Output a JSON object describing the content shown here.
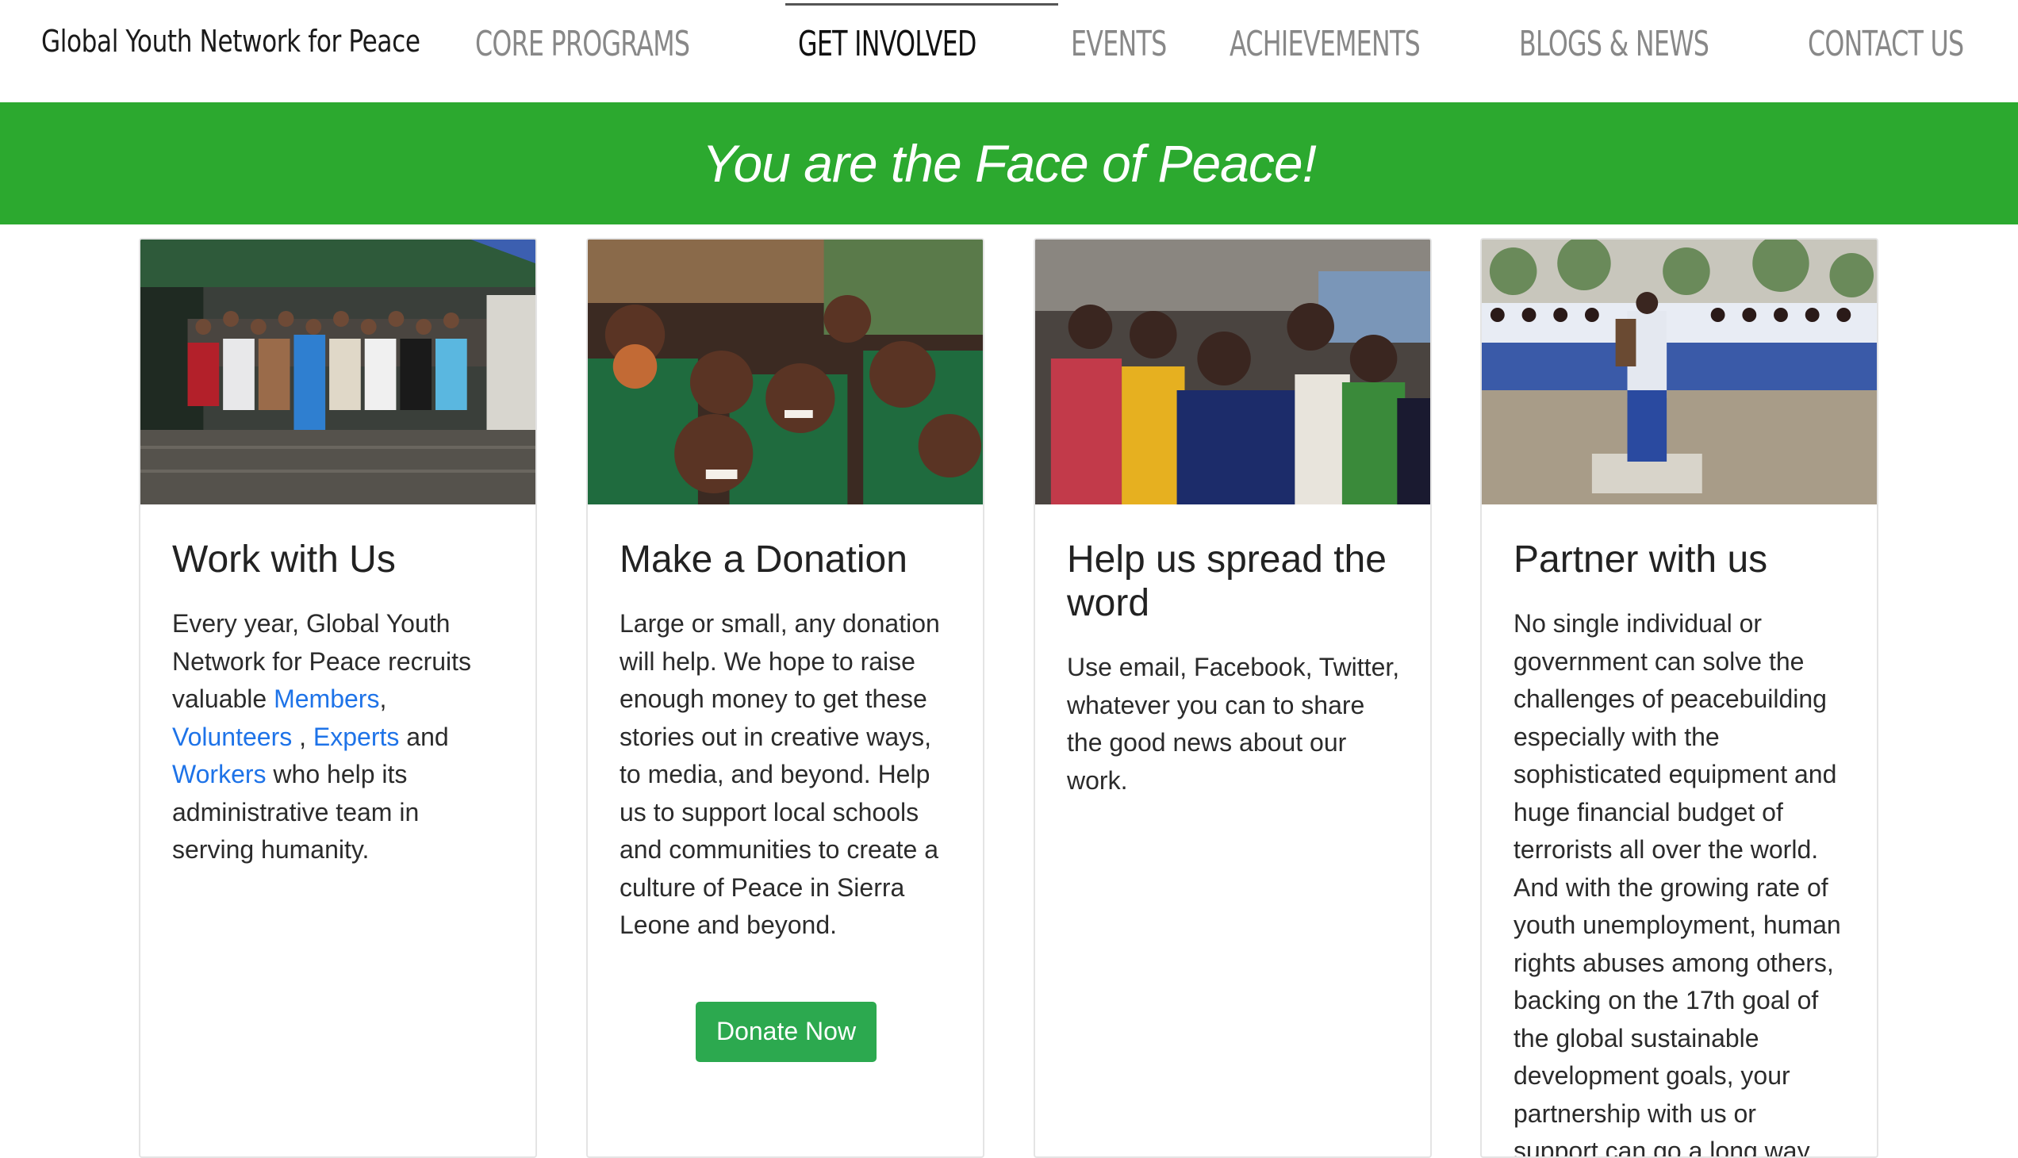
{
  "header": {
    "brand": "Global Youth Network for Peace",
    "nav": [
      {
        "label": "CORE PROGRAMS"
      },
      {
        "label": "GET INVOLVED"
      },
      {
        "label": "EVENTS"
      },
      {
        "label": "ACHIEVEMENTS"
      },
      {
        "label": "BLOGS & NEWS"
      },
      {
        "label": "CONTACT US"
      }
    ],
    "active_nav": "GET INVOLVED"
  },
  "banner": {
    "text": "You are the Face of Peace!",
    "color": "#2ca92f"
  },
  "cards": [
    {
      "title": "Work with Us",
      "text_before": "Every year, Global Youth Network for Peace recruits valuable ",
      "link_members": "Members",
      "sep1": ", ",
      "link_volunteers": "Volunteers",
      "sep2": " , ",
      "link_experts": "Experts",
      "sep3": " and ",
      "link_workers": "Workers",
      "text_after": " who help its administrative team in serving humanity."
    },
    {
      "title": "Make a Donation",
      "text": "Large or small, any donation will help. We hope to raise enough money to get these stories out in creative ways, to media, and beyond. Help us to support local schools and communities to create a culture of Peace in Sierra Leone and beyond.",
      "button": "Donate Now"
    },
    {
      "title": "Help us spread the word",
      "text": "Use email, Facebook, Twitter, whatever you can to share the good news about our work."
    },
    {
      "title": "Partner with us",
      "text": "No single individual or government can solve the challenges of peacebuilding especially with the sophisticated equipment and huge financial budget of terrorists all over the world. And with the growing rate of youth unemployment, human rights abuses among others, backing on the 17th goal of the global sustainable development goals, your partnership with us or support can go a long way"
    }
  ],
  "colors": {
    "accent_green": "#2ca92f",
    "button_green": "#2ca94f",
    "link_blue": "#1e73e8"
  }
}
